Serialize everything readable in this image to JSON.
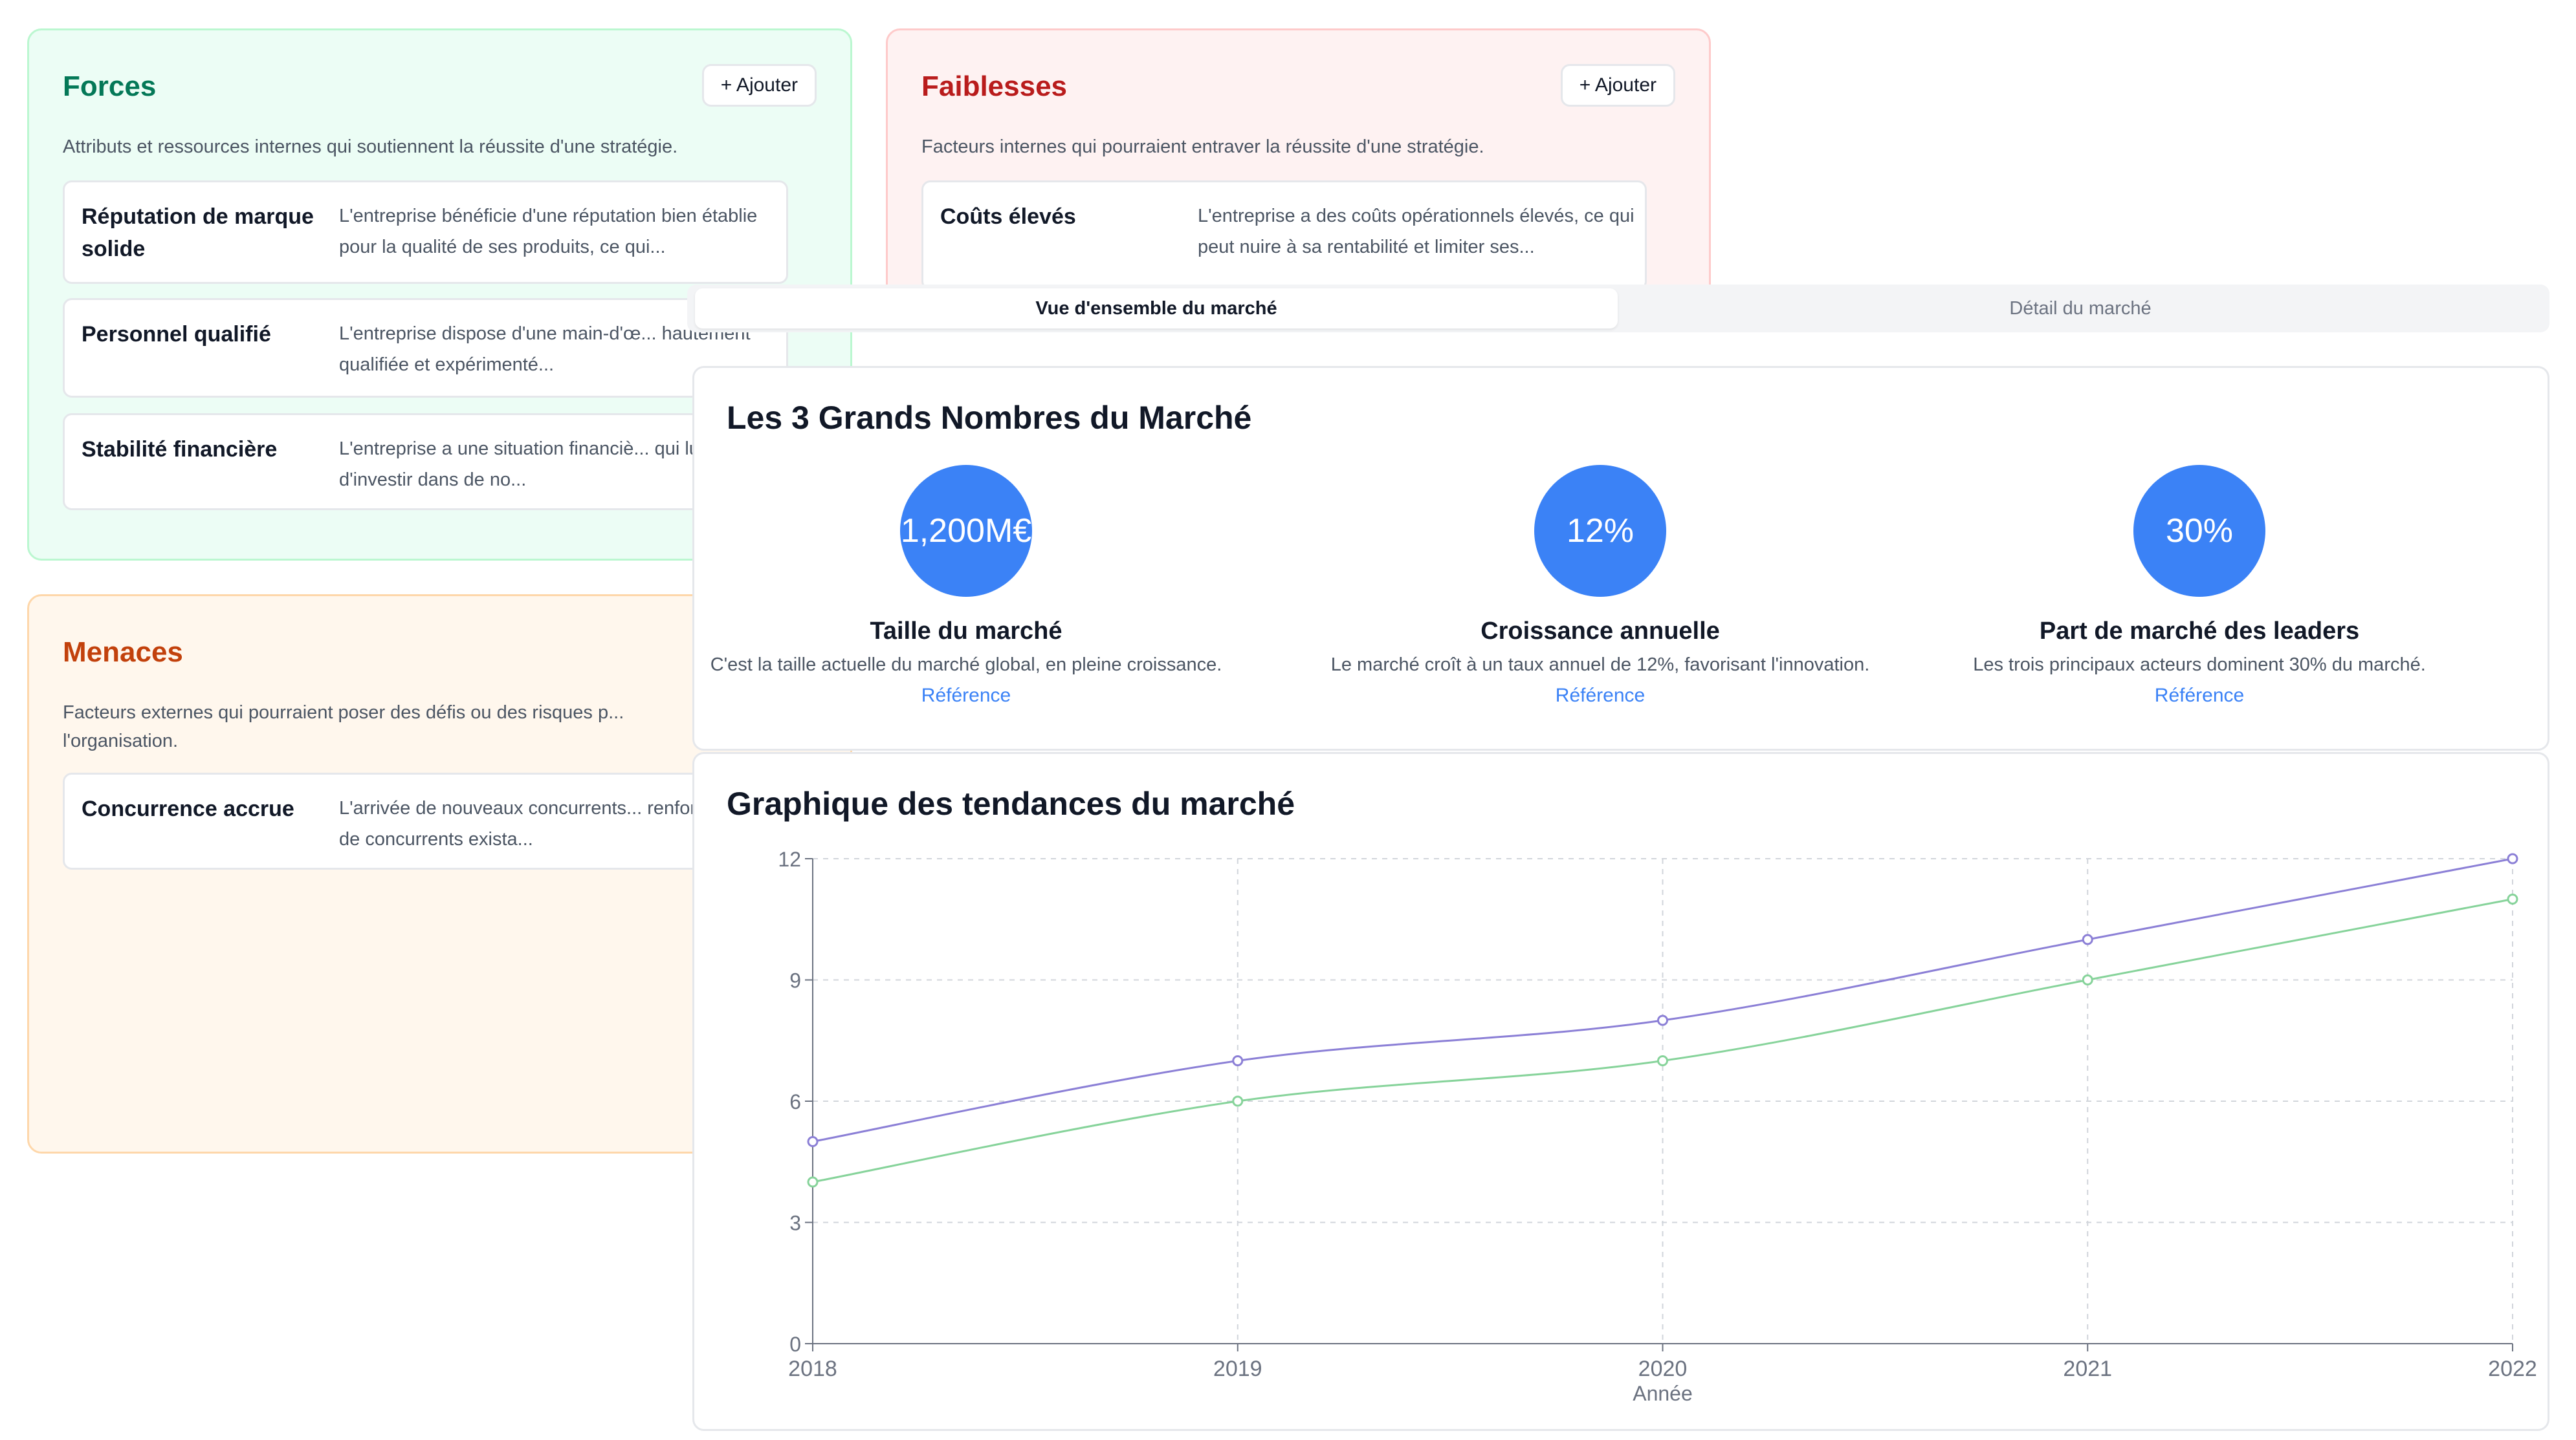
{
  "swot": {
    "forces": {
      "title": "Forces",
      "add_label": "+ Ajouter",
      "description": "Attributs et ressources internes qui soutiennent la réussite d'une stratégie.",
      "items": [
        {
          "title": "Réputation de marque solide",
          "text": "L'entreprise bénéficie d'une réputation bien établie pour la qualité de ses produits, ce qui..."
        },
        {
          "title": "Personnel qualifié",
          "text": "L'entreprise dispose d'une main-d'œ... hautement qualifiée et expérimenté..."
        },
        {
          "title": "Stabilité financière",
          "text": "L'entreprise a une situation financiè... qui lui permet d'investir dans de no..."
        }
      ]
    },
    "faiblesses": {
      "title": "Faiblesses",
      "add_label": "+ Ajouter",
      "description": "Facteurs internes qui pourraient entraver la réussite d'une stratégie.",
      "items": [
        {
          "title": "Coûts élevés",
          "text": "L'entreprise a des coûts opérationnels élevés, ce qui peut nuire à sa rentabilité et limiter ses..."
        }
      ]
    },
    "menaces": {
      "title": "Menaces",
      "description": "Facteurs externes qui pourraient poser des défis ou des risques p... l'organisation.",
      "items": [
        {
          "title": "Concurrence accrue",
          "text": "L'arrivée de nouveaux concurrents... renforcement de concurrents exista..."
        }
      ]
    }
  },
  "tabs": [
    {
      "label": "Vue d'ensemble du marché",
      "active": true
    },
    {
      "label": "Détail du marché",
      "active": false
    }
  ],
  "numbers": {
    "title": "Les 3 Grands Nombres du Marché",
    "link_label": "Référence",
    "metrics": [
      {
        "value": "1,200M€",
        "title": "Taille du marché",
        "desc": "C'est la taille actuelle du marché global, en pleine croissance."
      },
      {
        "value": "12%",
        "title": "Croissance annuelle",
        "desc": "Le marché croît à un taux annuel de 12%, favorisant l'innovation."
      },
      {
        "value": "30%",
        "title": "Part de marché des leaders",
        "desc": "Les trois principaux acteurs dominent 30% du marché."
      }
    ]
  },
  "chart_title": "Graphique des tendances du marché",
  "chart_data": {
    "type": "line",
    "x": [
      "2018",
      "2019",
      "2020",
      "2021",
      "2022"
    ],
    "xlabel": "Année",
    "ylabel": "",
    "ylim": [
      0,
      12
    ],
    "yticks": [
      0,
      3,
      6,
      9,
      12
    ],
    "grid": true,
    "series": [
      {
        "values": [
          5,
          7,
          8,
          10,
          12
        ],
        "color": "#8b7fd6"
      },
      {
        "values": [
          4,
          6,
          7,
          9,
          11
        ],
        "color": "#86d39a"
      }
    ]
  },
  "colors": {
    "accent": "#3b82f6",
    "forces": "#047857",
    "faiblesses": "#b91c1c",
    "menaces": "#c2410c"
  }
}
